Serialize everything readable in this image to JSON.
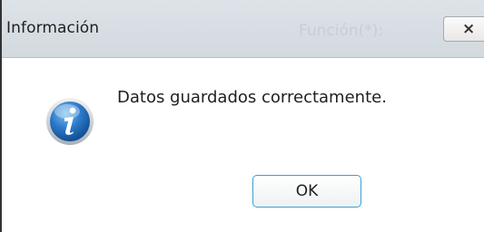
{
  "dialog": {
    "title": "Información",
    "background_label": "Función(*):",
    "close_label": "×",
    "message": "Datos guardados correctamente.",
    "ok_label": "OK",
    "icon": "info-icon"
  },
  "colors": {
    "title_bar": "#d6dce2",
    "ok_border": "#3b9fd6",
    "icon_blue": "#1c63b0"
  }
}
